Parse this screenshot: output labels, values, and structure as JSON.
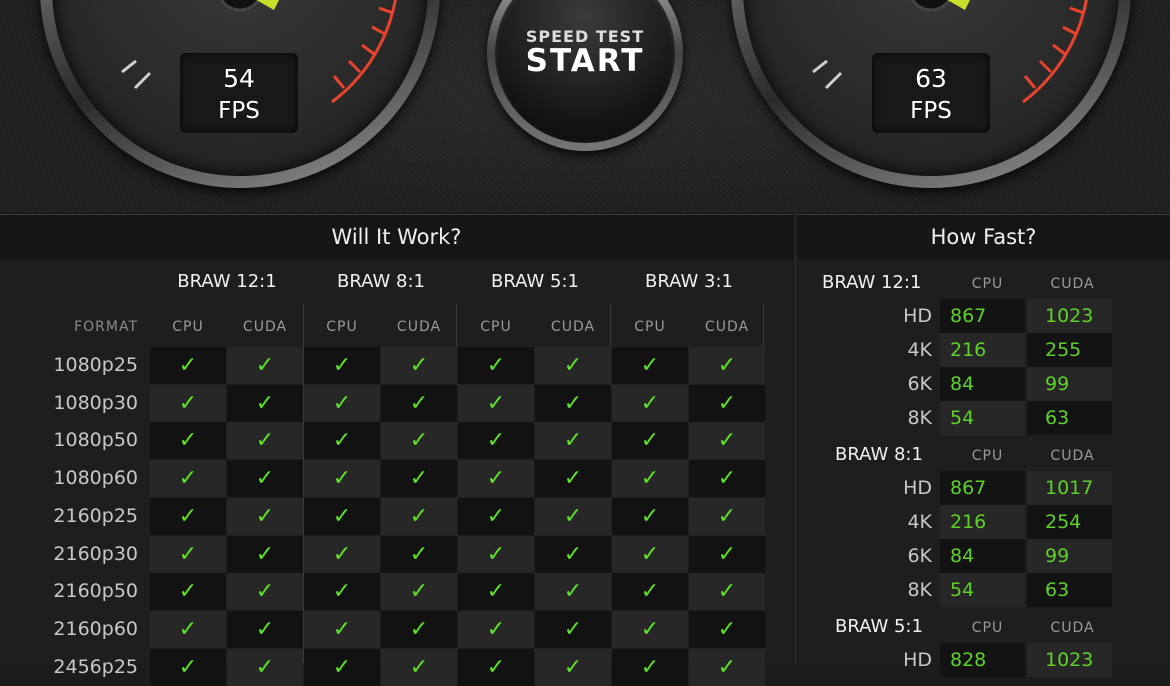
{
  "gauges": {
    "left": {
      "value": "54",
      "unit": "FPS"
    },
    "right": {
      "value": "63",
      "unit": "FPS"
    }
  },
  "start_button": {
    "sub_label": "SPEED TEST",
    "label": "START"
  },
  "will_it_work": {
    "title": "Will It Work?",
    "format_header": "FORMAT",
    "groups": [
      "BRAW 12:1",
      "BRAW 8:1",
      "BRAW 5:1",
      "BRAW 3:1"
    ],
    "sub_headers": [
      "CPU",
      "CUDA"
    ],
    "check_glyph": "✓",
    "rows": [
      {
        "format": "1080p25"
      },
      {
        "format": "1080p30"
      },
      {
        "format": "1080p50"
      },
      {
        "format": "1080p60"
      },
      {
        "format": "2160p25"
      },
      {
        "format": "2160p30"
      },
      {
        "format": "2160p50"
      },
      {
        "format": "2160p60"
      },
      {
        "format": "2456p25"
      }
    ]
  },
  "how_fast": {
    "title": "How Fast?",
    "groups": [
      {
        "name": "BRAW 12:1",
        "cpu_label": "CPU",
        "cuda_label": "CUDA",
        "rows": [
          {
            "res": "HD",
            "cpu": "867",
            "cuda": "1023"
          },
          {
            "res": "4K",
            "cpu": "216",
            "cuda": "255"
          },
          {
            "res": "6K",
            "cpu": "84",
            "cuda": "99"
          },
          {
            "res": "8K",
            "cpu": "54",
            "cuda": "63"
          }
        ]
      },
      {
        "name": "BRAW 8:1",
        "cpu_label": "CPU",
        "cuda_label": "CUDA",
        "rows": [
          {
            "res": "HD",
            "cpu": "867",
            "cuda": "1017"
          },
          {
            "res": "4K",
            "cpu": "216",
            "cuda": "254"
          },
          {
            "res": "6K",
            "cpu": "84",
            "cuda": "99"
          },
          {
            "res": "8K",
            "cpu": "54",
            "cuda": "63"
          }
        ]
      },
      {
        "name": "BRAW 5:1",
        "cpu_label": "CPU",
        "cuda_label": "CUDA",
        "rows": [
          {
            "res": "HD",
            "cpu": "828",
            "cuda": "1023"
          }
        ]
      }
    ]
  },
  "colors": {
    "check": "#5fe02a",
    "value": "#5fd02a",
    "redline": "#e8432e"
  }
}
